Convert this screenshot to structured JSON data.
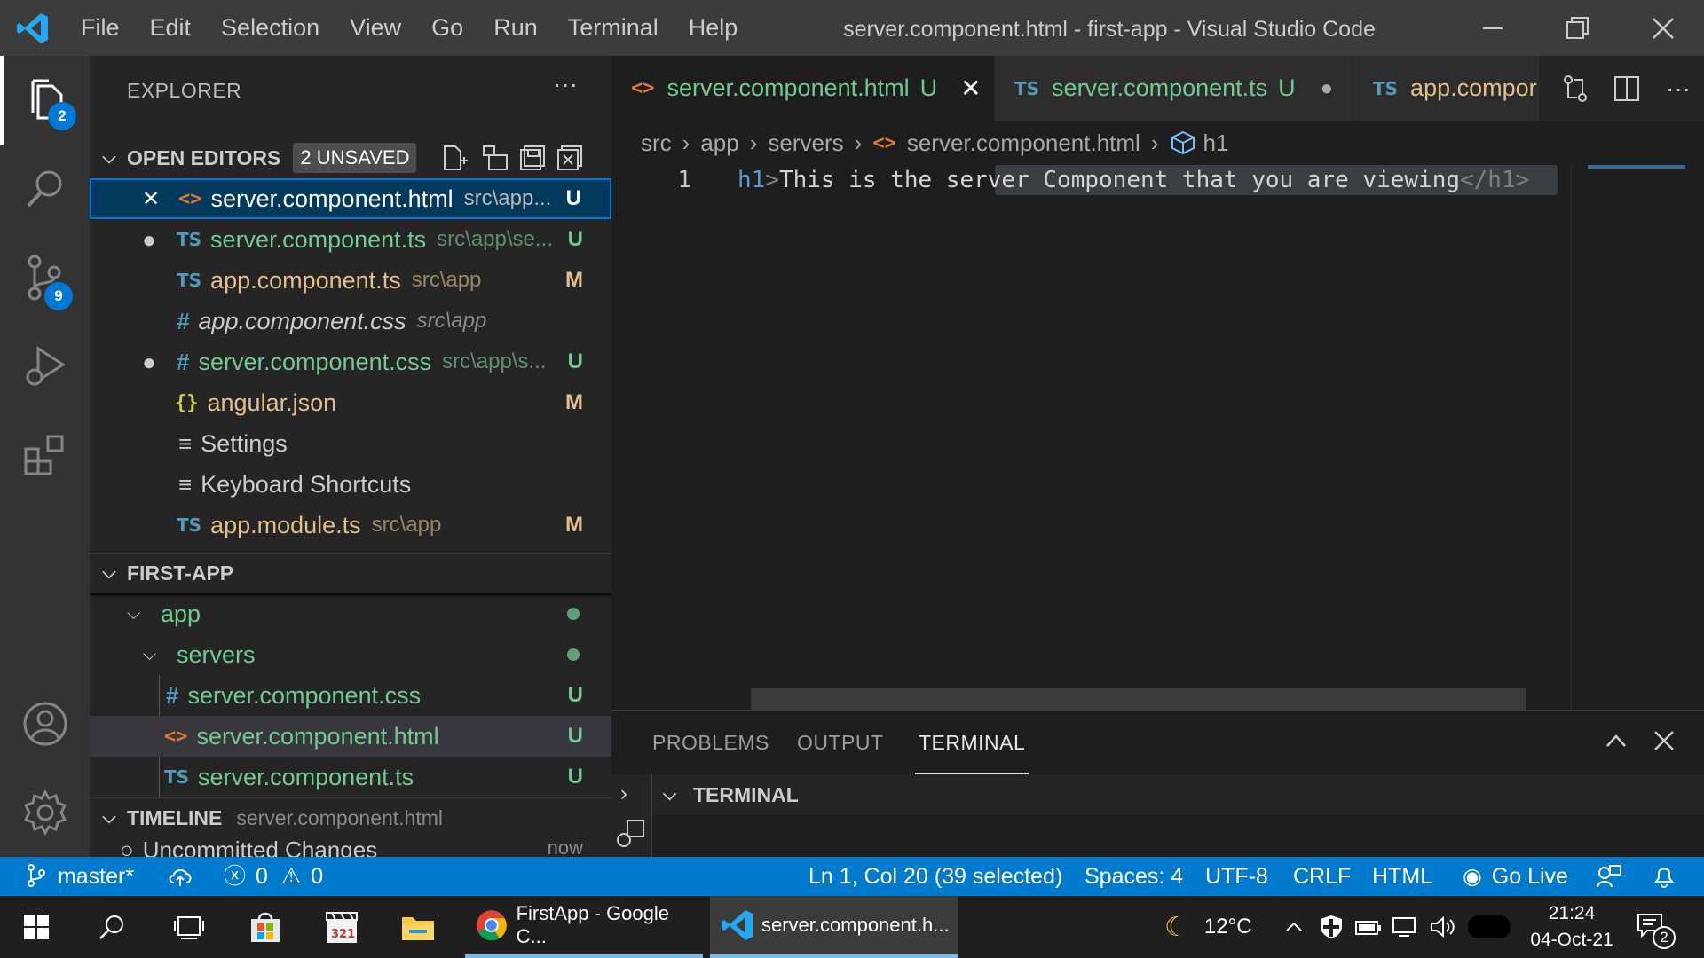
{
  "window": {
    "title": "server.component.html - first-app - Visual Studio Code",
    "menu": [
      "File",
      "Edit",
      "Selection",
      "View",
      "Go",
      "Run",
      "Terminal",
      "Help"
    ]
  },
  "activity": {
    "explorer_badge": "2",
    "scm_badge": "9"
  },
  "sidebar": {
    "title": "EXPLORER",
    "more": "···",
    "open_editors": {
      "header": "OPEN EDITORS",
      "badge": "2 UNSAVED",
      "items": [
        {
          "icon": "<>",
          "name": "server.component.html",
          "path": "src\\app...",
          "status": "U"
        },
        {
          "icon": "TS",
          "name": "server.component.ts",
          "path": "src\\app\\se...",
          "status": "U"
        },
        {
          "icon": "TS",
          "name": "app.component.ts",
          "path": "src\\app",
          "status": "M"
        },
        {
          "icon": "#",
          "name": "app.component.css",
          "path": "src\\app",
          "status": ""
        },
        {
          "icon": "#",
          "name": "server.component.css",
          "path": "src\\app\\s...",
          "status": "U"
        },
        {
          "icon": "{}",
          "name": "angular.json",
          "path": "",
          "status": "M"
        },
        {
          "icon": "≡",
          "name": "Settings",
          "path": "",
          "status": ""
        },
        {
          "icon": "≡",
          "name": "Keyboard Shortcuts",
          "path": "",
          "status": ""
        },
        {
          "icon": "TS",
          "name": "app.module.ts",
          "path": "src\\app",
          "status": "M"
        }
      ]
    },
    "project": {
      "header": "FIRST-APP",
      "items": [
        {
          "name": "app"
        },
        {
          "name": "servers"
        },
        {
          "icon": "#",
          "name": "server.component.css",
          "status": "U"
        },
        {
          "icon": "<>",
          "name": "server.component.html",
          "status": "U"
        },
        {
          "icon": "TS",
          "name": "server.component.ts",
          "status": "U"
        }
      ]
    },
    "timeline": {
      "header": "TIMELINE",
      "file": "server.component.html",
      "entry": "Uncommitted Changes",
      "entry_time": "now"
    }
  },
  "editor": {
    "tabs": [
      {
        "icon": "<>",
        "name": "server.component.html",
        "status": "U",
        "control": "✕"
      },
      {
        "icon": "TS",
        "name": "server.component.ts",
        "status": "U",
        "control": "●"
      },
      {
        "icon": "TS",
        "name": "app.compor"
      }
    ],
    "breadcrumbs": [
      "src",
      "app",
      "servers",
      "server.component.html",
      "h1"
    ],
    "line_number": "1",
    "code": {
      "tag_open": "h1",
      "bracket_open": ">",
      "text_plain": "This is the ser",
      "text_selected": "ver Component that you are viewing",
      "close": "</h1>"
    }
  },
  "panel": {
    "tabs": [
      "PROBLEMS",
      "OUTPUT",
      "TERMINAL"
    ],
    "terminal_header": "TERMINAL"
  },
  "statusbar": {
    "branch": "master*",
    "errors": "0",
    "warnings": "0",
    "position": "Ln 1, Col 20 (39 selected)",
    "spaces": "Spaces: 4",
    "encoding": "UTF-8",
    "eol": "CRLF",
    "language": "HTML",
    "golive": "Go Live"
  },
  "taskbar": {
    "apps": [
      {
        "label": "FirstApp - Google C..."
      },
      {
        "label": "server.component.h..."
      }
    ],
    "temperature": "12°C",
    "time": "21:24",
    "date": "04-Oct-21",
    "notifications": "2"
  },
  "colors": {
    "accent": "#007acc",
    "untracked": "#73c991",
    "modified": "#e2c08d"
  }
}
